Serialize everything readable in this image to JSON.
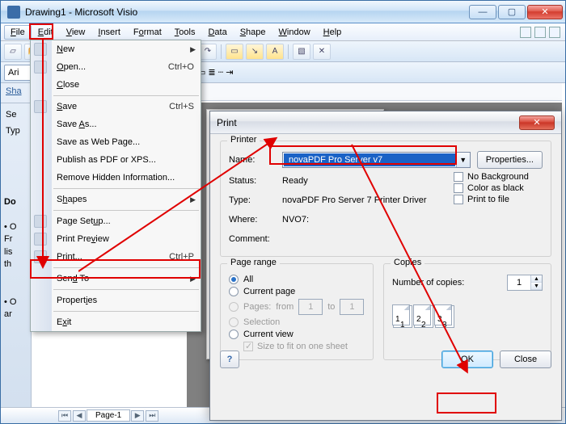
{
  "window": {
    "title": "Drawing1 - Microsoft Visio"
  },
  "menubar": {
    "items": [
      "File",
      "Edit",
      "View",
      "Insert",
      "Format",
      "Tools",
      "Data",
      "Shape",
      "Window",
      "Help"
    ],
    "active": 0
  },
  "format_bar": {
    "font": "Ari",
    "size": ""
  },
  "left_tabs": {
    "shapes": "Sha",
    "search": "Se",
    "type": "Typ"
  },
  "side_para1": {
    "l0": "Do",
    "l1": "• O",
    "l2": "Fr",
    "l3": "lis",
    "l4": "th"
  },
  "side_para2": {
    "l0": "• O",
    "l1": "ar"
  },
  "file_menu": {
    "new": "New",
    "open": "Open...",
    "open_sc": "Ctrl+O",
    "close": "Close",
    "save": "Save",
    "save_sc": "Ctrl+S",
    "saveas": "Save As...",
    "savewp": "Save as Web Page...",
    "pubpdf": "Publish as PDF or XPS...",
    "remhid": "Remove Hidden Information...",
    "shapes": "Shapes",
    "pagesu": "Page Setup...",
    "printprev": "Print Preview",
    "print": "Print...",
    "print_sc": "Ctrl+P",
    "sendto": "Send To",
    "props": "Properties",
    "exit": "Exit"
  },
  "statusbar": {
    "page1": "Page-1"
  },
  "print": {
    "title": "Print",
    "printer_group": "Printer",
    "name_label": "Name:",
    "name_value": "novaPDF Pro Server v7",
    "properties_btn": "Properties...",
    "status_label": "Status:",
    "status_value": "Ready",
    "type_label": "Type:",
    "type_value": "novaPDF Pro Server 7 Printer Driver",
    "where_label": "Where:",
    "where_value": "NVO7:",
    "comment_label": "Comment:",
    "nobg": "No Background",
    "colblack": "Color as black",
    "ptf": "Print to file",
    "range_group": "Page range",
    "all": "All",
    "current_page": "Current page",
    "pages": "Pages:",
    "from": "from",
    "to": "to",
    "from_v": "1",
    "to_v": "1",
    "selection": "Selection",
    "current_view": "Current view",
    "fit": "Size to fit on one sheet",
    "copies_group": "Copies",
    "numcopies": "Number of copies:",
    "copies_v": "1",
    "ok": "OK",
    "close": "Close"
  }
}
